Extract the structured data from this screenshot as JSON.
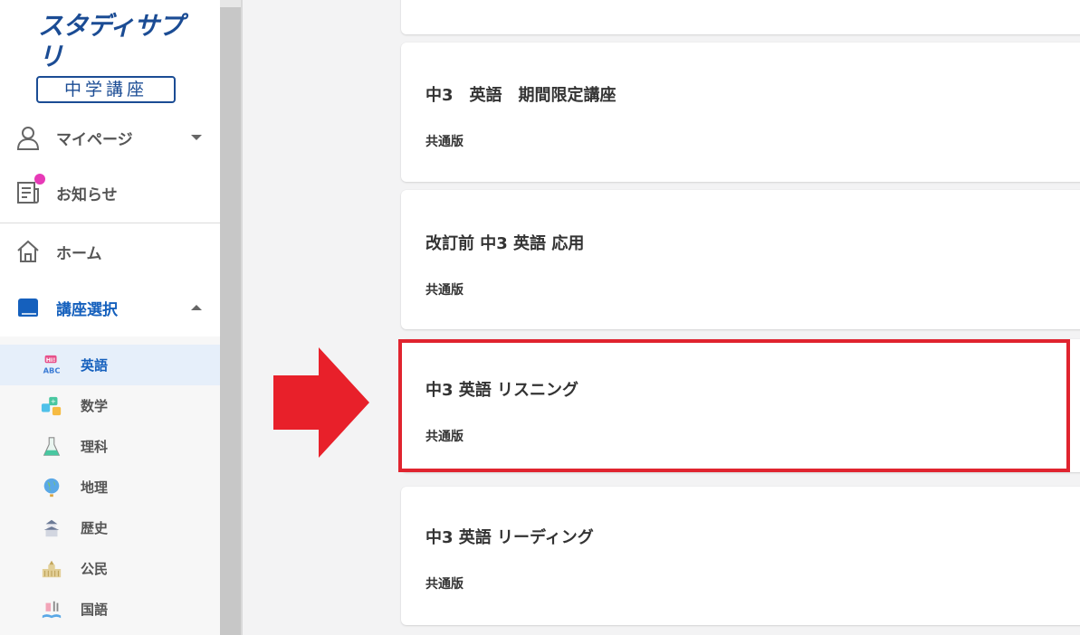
{
  "logo": {
    "brand": "スタディサプリ",
    "product": "中学講座"
  },
  "nav": {
    "mypage": "マイページ",
    "news": "お知らせ",
    "home": "ホーム",
    "course_select": "講座選択"
  },
  "subjects": [
    {
      "label": "英語",
      "icon": "english-abc-icon",
      "active": true
    },
    {
      "label": "数学",
      "icon": "math-icon",
      "active": false
    },
    {
      "label": "理科",
      "icon": "science-flask-icon",
      "active": false
    },
    {
      "label": "地理",
      "icon": "globe-icon",
      "active": false
    },
    {
      "label": "歴史",
      "icon": "castle-icon",
      "active": false
    },
    {
      "label": "公民",
      "icon": "parliament-icon",
      "active": false
    },
    {
      "label": "国語",
      "icon": "book-icon",
      "active": false
    }
  ],
  "courses": [
    {
      "title": "中3　英語　期間限定講座",
      "edition": "共通版"
    },
    {
      "title": "改訂前 中3 英語 応用",
      "edition": "共通版"
    },
    {
      "title": "中3 英語 リスニング",
      "edition": "共通版",
      "highlighted": true
    },
    {
      "title": "中3 英語 リーディング",
      "edition": "共通版"
    }
  ],
  "colors": {
    "brand_blue": "#1b4c94",
    "active_blue": "#1560bd",
    "highlight_red": "#e0242f",
    "notify_pink": "#e73ab7"
  }
}
